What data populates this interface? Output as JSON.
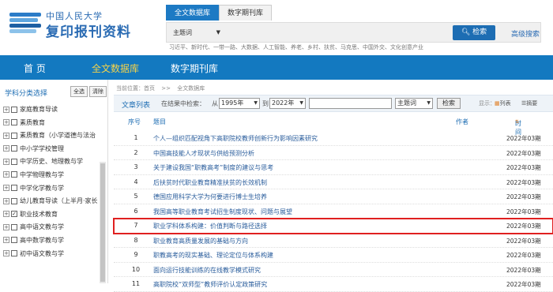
{
  "logo": {
    "org": "中国人民大学",
    "name": "复印报刊资料"
  },
  "search": {
    "tabs": [
      "全文数据库",
      "数字期刊库"
    ],
    "field": "主题词",
    "button": "检索",
    "advanced": "高级搜索",
    "hot_terms": "习近平、新时代、一带一路、大数据、人工智能、养老、乡村、扶贫、马克思、中国外交、文化创意产业"
  },
  "nav": [
    "首 页",
    "全文数据库",
    "数字期刊库"
  ],
  "sidebar": {
    "title": "学科分类选择",
    "select_all": "全选",
    "clear": "清除",
    "items": [
      {
        "label": "家庭教育导读",
        "checked": false
      },
      {
        "label": "素质教育",
        "checked": false
      },
      {
        "label": "素质教育（小学道德与法治",
        "checked": false
      },
      {
        "label": "中小学学校管理",
        "checked": false
      },
      {
        "label": "中学历史、地理教与学",
        "checked": false
      },
      {
        "label": "中学物理教与学",
        "checked": false
      },
      {
        "label": "中学化学教与学",
        "checked": false
      },
      {
        "label": "幼儿教育导读（上半月·家长",
        "checked": false
      },
      {
        "label": "职业技术教育",
        "checked": true
      },
      {
        "label": "高中语文教与学",
        "checked": false
      },
      {
        "label": "高中数学教与学",
        "checked": false
      },
      {
        "label": "初中语文教与学",
        "checked": false
      }
    ]
  },
  "main": {
    "breadcrumb": [
      "当前位置：首页",
      ">>",
      "全文数据库"
    ],
    "toolbar": {
      "title": "文章列表",
      "within": "在结果中检索：",
      "from": "从",
      "year_from": "1995年",
      "to": "到",
      "year_to": "2022年",
      "field": "主题词",
      "button": "检索",
      "display": "显示：",
      "list": "列表",
      "summary": "摘要"
    },
    "columns": {
      "no": "序号",
      "title": "题目",
      "author": "作者",
      "time": "时间"
    },
    "rows": [
      {
        "no": "1",
        "title": "个人—组织匹配视角下高职院校教师创新行为影响因素研究",
        "date": "2022年03期"
      },
      {
        "no": "2",
        "title": "中国高技能人才现状与供给预测分析",
        "date": "2022年03期"
      },
      {
        "no": "3",
        "title": "关于建设我国“职教高考”制度的建议与思考",
        "date": "2022年03期"
      },
      {
        "no": "4",
        "title": "后扶贫时代职业教育精准扶贫的长效机制",
        "date": "2022年03期"
      },
      {
        "no": "5",
        "title": "德国应用科学大学为何要进行博士生培养",
        "date": "2022年03期"
      },
      {
        "no": "6",
        "title": "我国高等职业教育考试招生制度现状、问题与展望",
        "date": "2022年03期"
      },
      {
        "no": "7",
        "title": "职业学科体系构建：价值判断与路径选择",
        "date": "2022年03期"
      },
      {
        "no": "8",
        "title": "职业教育高质量发展的基础与方向",
        "date": "2022年03期"
      },
      {
        "no": "9",
        "title": "职教高考的现实基础、理论定位与体系构建",
        "date": "2022年03期"
      },
      {
        "no": "10",
        "title": "面向运行技能训练的在线教学模式研究",
        "date": "2022年03期"
      },
      {
        "no": "11",
        "title": "高职院校“双师型”教师评价认定政策研究",
        "date": "2022年03期"
      }
    ],
    "highlighted_row": 7
  },
  "colors": {
    "brand": "#1d6db3",
    "nav": "#1379c0",
    "nav_active": "#f5d34a",
    "highlight": "#e02020"
  }
}
